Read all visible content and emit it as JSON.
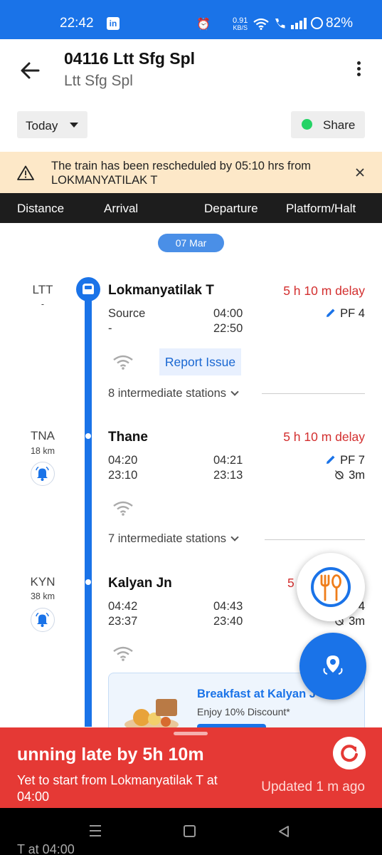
{
  "status_bar": {
    "time": "22:42",
    "app_icon": "linkedin-icon",
    "indicator_icons": "⏰ ▮ ",
    "net_speed": "0.91",
    "net_unit": "KB/S",
    "battery": "82%"
  },
  "header": {
    "title": "04116 Ltt Sfg Spl",
    "subtitle": "Ltt Sfg Spl"
  },
  "controls": {
    "day_select": "Today",
    "share_label": "Share"
  },
  "alert": {
    "message": "The train has been rescheduled by 05:10 hrs from LOKMANYATILAK T"
  },
  "columns": {
    "distance": "Distance",
    "arrival": "Arrival",
    "departure": "Departure",
    "platform": "Platform/Halt"
  },
  "date_pill": "07 Mar",
  "stations": [
    {
      "code": "LTT",
      "km": "-",
      "name": "Lokmanyatilak T",
      "delay": "5 h 10 m delay",
      "arr_expected": "Source",
      "arr_sched": "-",
      "dep_expected": "04:00",
      "dep_sched": "22:50",
      "platform": "PF 4",
      "report_label": "Report Issue",
      "intermediate": "8 intermediate stations"
    },
    {
      "code": "TNA",
      "km": "18 km",
      "name": "Thane",
      "delay": "5 h 10 m delay",
      "arr_expected": "04:20",
      "arr_sched": "23:10",
      "dep_expected": "04:21",
      "dep_sched": "23:13",
      "platform": "PF 7",
      "halt": "3m",
      "intermediate": "7 intermediate stations"
    },
    {
      "code": "KYN",
      "km": "38 km",
      "name": "Kalyan Jn",
      "delay": "5",
      "arr_expected": "04:42",
      "arr_sched": "23:37",
      "dep_expected": "04:43",
      "dep_sched": "23:40",
      "platform": "4",
      "halt": "3m"
    }
  ],
  "promo": {
    "title": "Breakfast at Kalyan J",
    "subtitle": "Enjoy 10% Discount*"
  },
  "running_late": {
    "headline": "unning late by 5h 10m",
    "detail": "Yet to start from Lokmanyatilak T at 04:00",
    "updated": "Updated 1 m  ago",
    "ghost_text": "T at 04:00"
  },
  "colors": {
    "primary": "#1a73e8",
    "delay_red": "#d32f2f",
    "late_banner": "#e53935",
    "alert_bg": "#fde8c8"
  }
}
